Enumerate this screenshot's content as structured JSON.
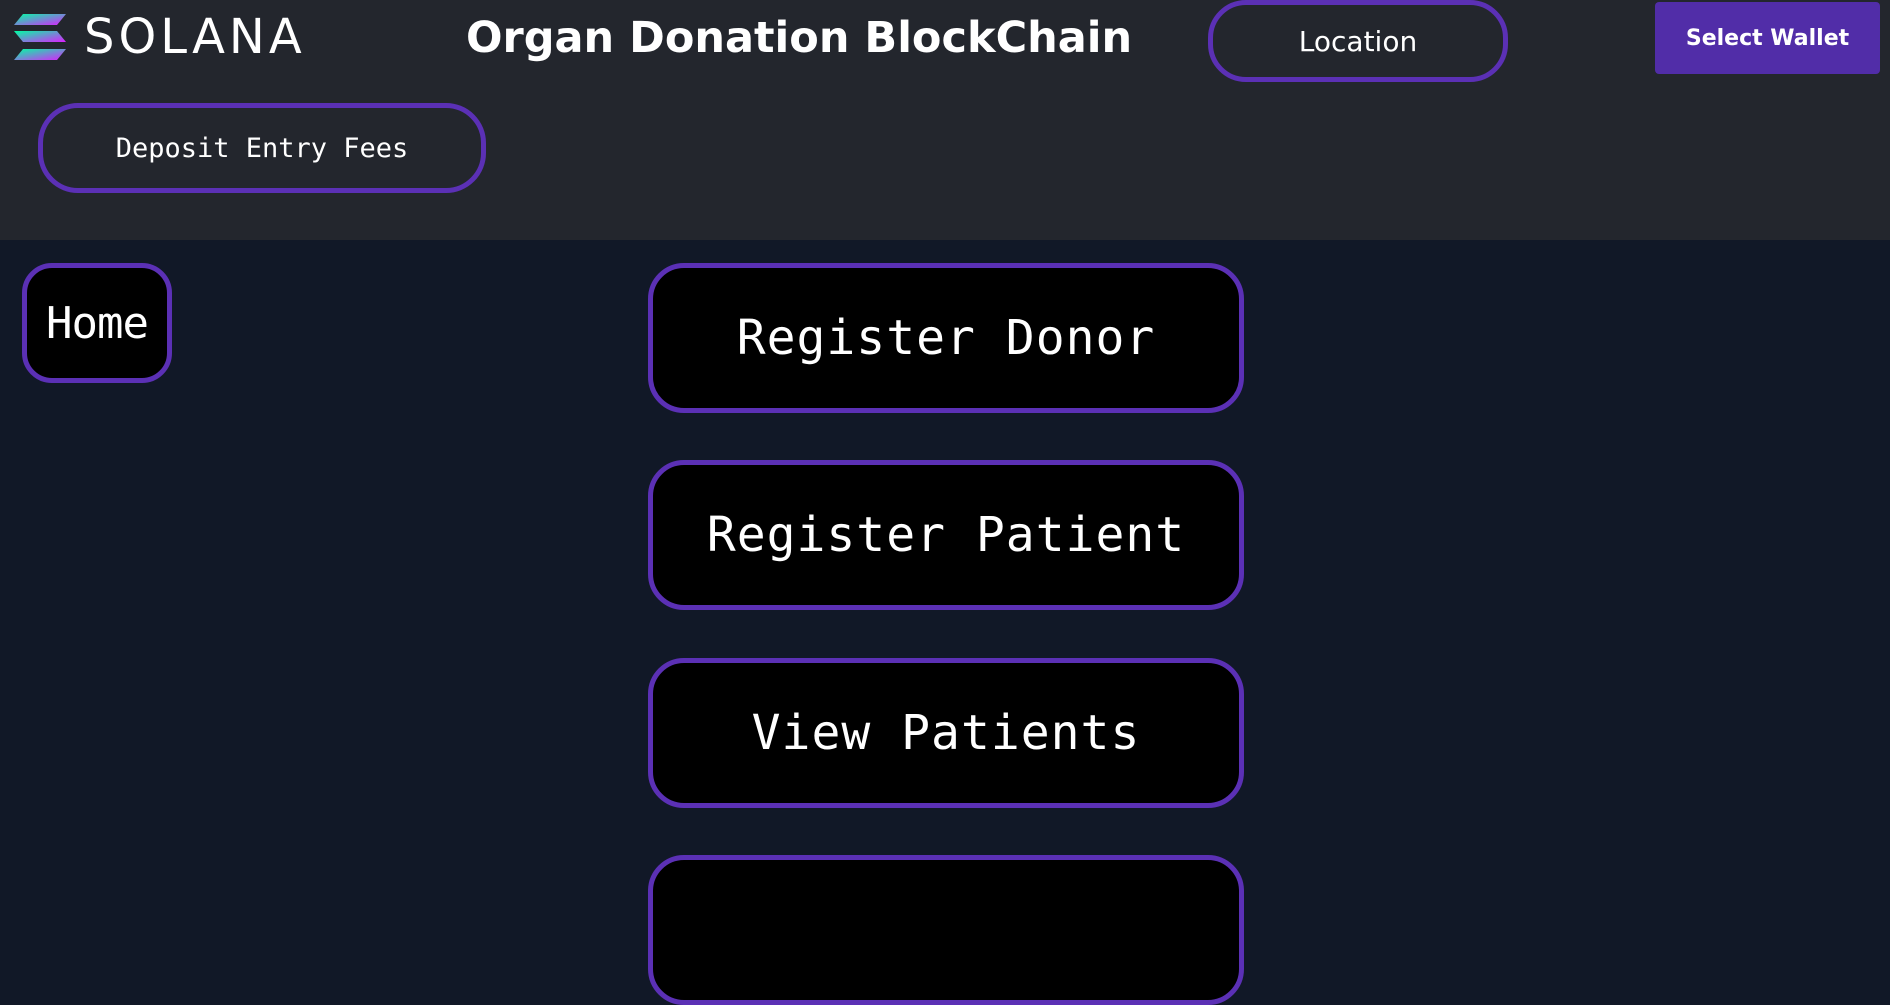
{
  "header": {
    "logo_text": "SOLANA",
    "title": "Organ Donation BlockChain",
    "location_label": "Location",
    "wallet_label": "Select Wallet",
    "deposit_label": "Deposit Entry Fees"
  },
  "sidebar": {
    "home_label": "Home"
  },
  "menu": {
    "items": [
      {
        "label": "Register Donor"
      },
      {
        "label": "Register Patient"
      },
      {
        "label": "View Patients"
      },
      {
        "label": ""
      }
    ]
  },
  "colors": {
    "header_bg": "#23262d",
    "page_bg": "#111827",
    "accent": "#5b30b5",
    "wallet_bg": "#512da8",
    "button_bg": "#000000",
    "text": "#ffffff"
  },
  "icons": {
    "logo": "solana-logo-icon"
  }
}
